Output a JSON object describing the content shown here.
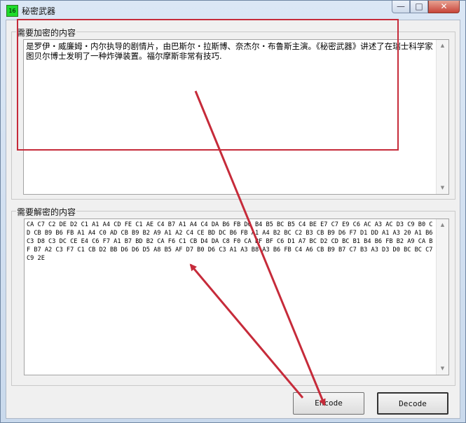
{
  "window": {
    "icon_text": "16",
    "title": "秘密武器",
    "minimize_glyph": "—",
    "maximize_glyph": "□",
    "close_glyph": "✕"
  },
  "encrypt_group": {
    "label": "需要加密的内容",
    "text": "是罗伊・威廉姆・内尔执导的剧情片，由巴斯尔・拉斯博、奈杰尔・布鲁斯主演。《秘密武器》讲述了在瑞士科学家图贝尔博士发明了一种炸弹装置。福尔摩斯非常有技巧."
  },
  "decrypt_group": {
    "label": "需要解密的内容",
    "text": "CA C7 C2 DE D2 C1 A1 A4 CD FE C1 AE C4 B7 A1 A4 C4 DA B6 FB D6 B4 B5 BC B5 C4 BE E7 C7 E9 C6 AC A3 AC D3 C9 B0 CD CB B9 B6 FB A1 A4 C0 AD CB B9 B2 A9 A1 A2 C4 CE BD DC B6 FB A1 A4 B2 BC C2 B3 CB B9 D6 F7 D1 DD A1 A3 20 A1 B6 C3 D8 C3 DC CE E4 C6 F7 A1 B7 BD B2 CA F6 C1 CB D4 DA C8 F0 CA BF BF C6 D1 A7 BC D2 CD BC B1 B4 B6 FB B2 A9 CA BF B7 A2 C3 F7 C1 CB D2 BB D6 D6 D5 A8 B5 AF D7 B0 D6 C3 A1 A3 B8 A3 B6 FB C4 A6 CB B9 B7 C7 B3 A3 D3 D0 BC BC C7 C9 2E"
  },
  "scroll": {
    "up_glyph": "▲",
    "down_glyph": "▼"
  },
  "buttons": {
    "encode_label": "Encode",
    "decode_label": "Decode"
  },
  "colors": {
    "annotation": "#c62b3a",
    "close_button": "#c7453a"
  }
}
